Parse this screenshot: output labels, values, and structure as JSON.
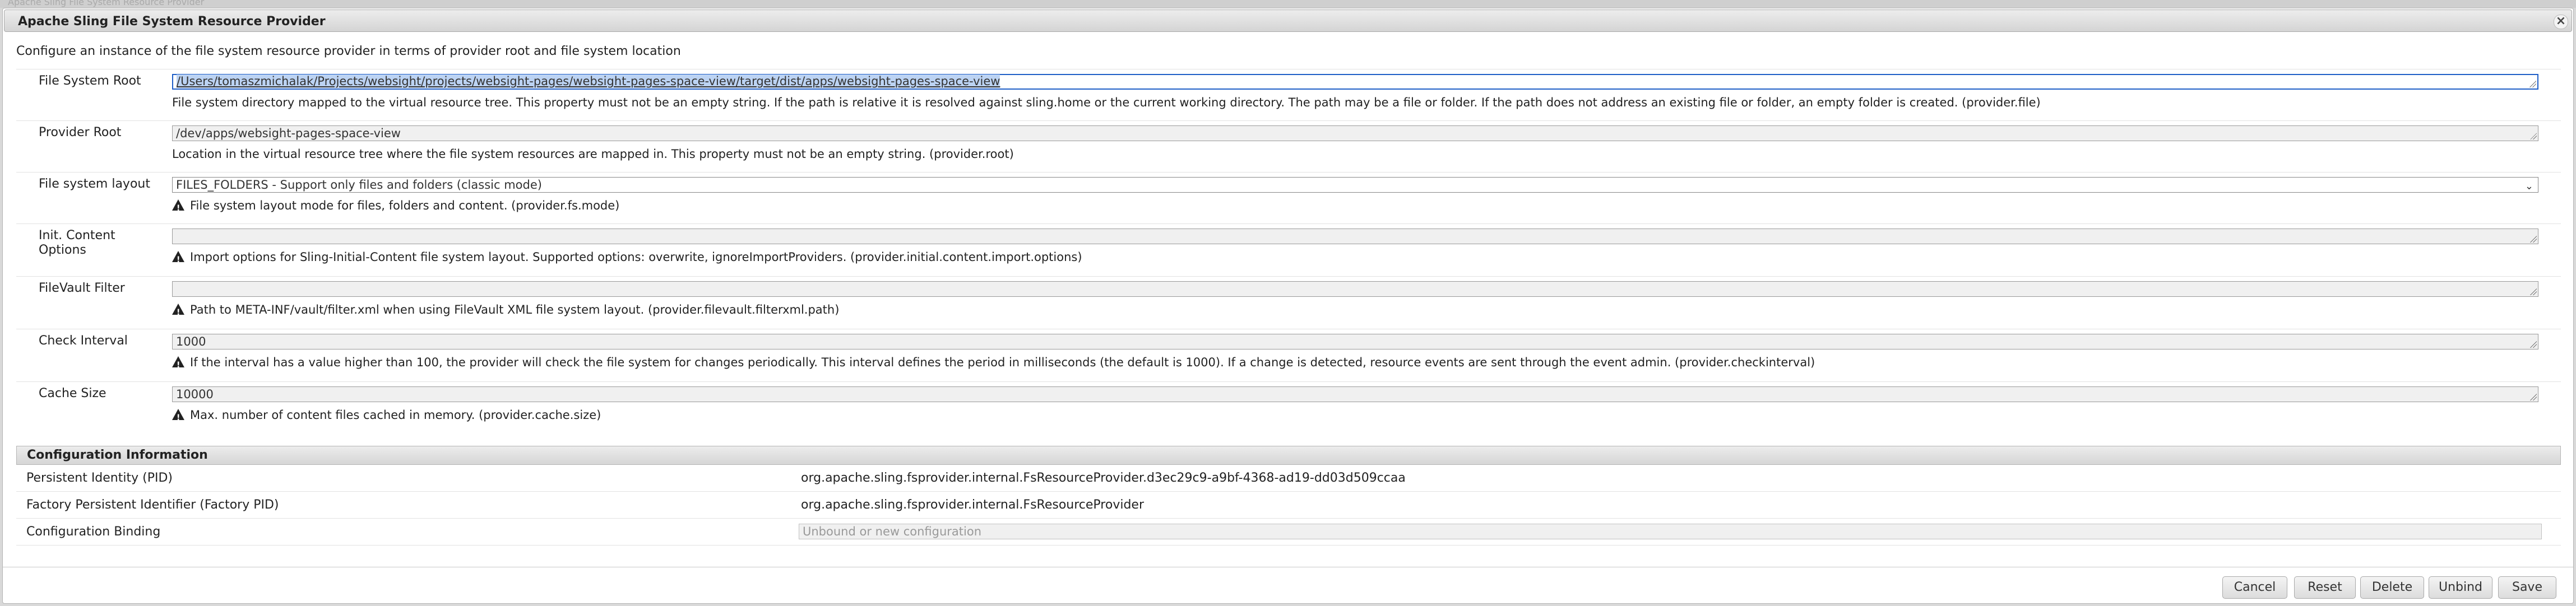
{
  "background_title": "Apache Sling File System Resource Provider",
  "dialog": {
    "title": "Apache Sling File System Resource Provider",
    "description": "Configure an instance of the file system resource provider in terms of provider root and file system location"
  },
  "fields": [
    {
      "label": "File System Root",
      "value": "/Users/tomaszmichalak/Projects/websight/projects/websight-pages/websight-pages-space-view/target/dist/apps/websight-pages-space-view",
      "help": "File system directory mapped to the virtual resource tree. This property must not be an empty string. If the path is relative it is resolved against sling.home or the current working directory. The path may be a file or folder. If the path does not address an existing file or folder, an empty folder is created. (provider.file)"
    },
    {
      "label": "Provider Root",
      "value": "/dev/apps/websight-pages-space-view",
      "help": "Location in the virtual resource tree where the file system resources are mapped in. This property must not be an empty string. (provider.root)"
    },
    {
      "label": "File system layout",
      "value": "FILES_FOLDERS - Support only files and folders (classic mode)",
      "help": "File system layout mode for files, folders and content. (provider.fs.mode)"
    },
    {
      "label": "Init. Content Options",
      "value": "",
      "help": "Import options for Sling-Initial-Content file system layout. Supported options: overwrite, ignoreImportProviders. (provider.initial.content.import.options)"
    },
    {
      "label": "FileVault Filter",
      "value": "",
      "help": "Path to META-INF/vault/filter.xml when using FileVault XML file system layout. (provider.filevault.filterxml.path)"
    },
    {
      "label": "Check Interval",
      "value": "1000",
      "help": "If the interval has a value higher than 100, the provider will check the file system for changes periodically. This interval defines the period in milliseconds (the default is 1000). If a change is detected, resource events are sent through the event admin. (provider.checkinterval)"
    },
    {
      "label": "Cache Size",
      "value": "10000",
      "help": "Max. number of content files cached in memory. (provider.cache.size)"
    }
  ],
  "config_info": {
    "heading": "Configuration Information",
    "pid_label": "Persistent Identity (PID)",
    "pid_value": "org.apache.sling.fsprovider.internal.FsResourceProvider.d3ec29c9-a9bf-4368-ad19-dd03d509ccaa",
    "factory_pid_label": "Factory Persistent Identifier (Factory PID)",
    "factory_pid_value": "org.apache.sling.fsprovider.internal.FsResourceProvider",
    "binding_label": "Configuration Binding",
    "binding_placeholder": "Unbound or new configuration"
  },
  "buttons": {
    "cancel": "Cancel",
    "reset": "Reset",
    "delete": "Delete",
    "unbind": "Unbind",
    "save": "Save"
  },
  "icons": {
    "close": "close-icon",
    "warning": "warning-icon",
    "dropdown": "chevron-down-icon",
    "resize": "resize-grip-icon"
  },
  "colors": {
    "focus_border": "#1f5fc7",
    "selection": "#bcd3f3"
  }
}
